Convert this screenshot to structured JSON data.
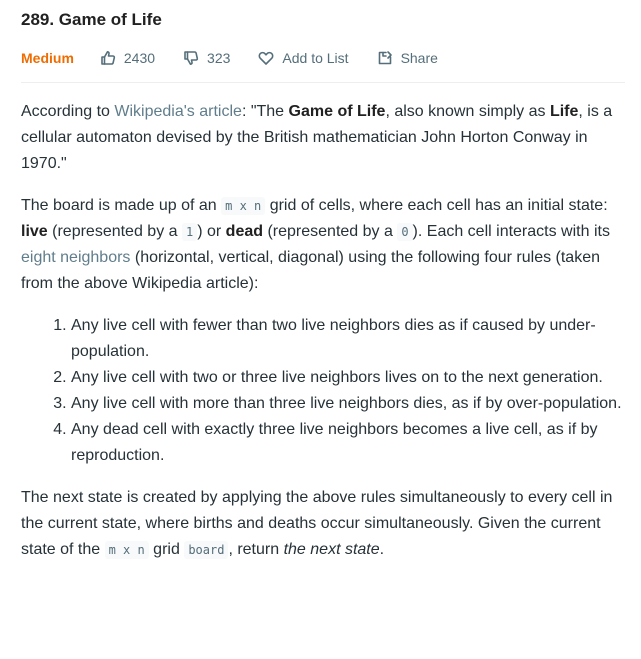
{
  "problem": {
    "title": "289. Game of Life",
    "difficulty": "Medium",
    "likes": "2430",
    "dislikes": "323",
    "add_to_list": "Add to List",
    "share": "Share"
  },
  "colors": {
    "difficulty_medium": "#ef6c00",
    "link": "#607d8b",
    "text": "#263238"
  },
  "icons": {
    "likes": "thumbs-up-icon",
    "dislikes": "thumbs-down-icon",
    "add_to_list": "heart-icon",
    "share": "share-icon"
  },
  "description": {
    "p1": {
      "t1": "According to ",
      "link": "Wikipedia's article",
      "t2": ": \"The ",
      "b1": "Game of Life",
      "t3": ", also known simply as ",
      "b2": "Life",
      "t4": ", is a cellular automaton devised by the British mathematician John Horton Conway in 1970.\""
    },
    "p2": {
      "t1": "The board is made up of an ",
      "code1": "m x n",
      "t2": " grid of cells, where each cell has an initial state: ",
      "b1": "live",
      "t3": " (represented by a ",
      "code2": "1",
      "t4": ") or ",
      "b2": "dead",
      "t5": " (represented by a ",
      "code3": "0",
      "t6": "). Each cell interacts with its ",
      "link": "eight neighbors",
      "t7": " (horizontal, vertical, diagonal) using the following four rules (taken from the above Wikipedia article):"
    },
    "rules": [
      "Any live cell with fewer than two live neighbors dies as if caused by under-population.",
      "Any live cell with two or three live neighbors lives on to the next generation.",
      "Any live cell with more than three live neighbors dies, as if by over-population.",
      "Any dead cell with exactly three live neighbors becomes a live cell, as if by reproduction."
    ],
    "p3": {
      "t1": "The next state is created by applying the above rules simultaneously to every cell in the current state, where births and deaths occur simultaneously. Given the current state of the ",
      "code1": "m x n",
      "t2": " grid ",
      "code2": "board",
      "t3": ", return ",
      "em": "the next state",
      "t4": "."
    }
  }
}
